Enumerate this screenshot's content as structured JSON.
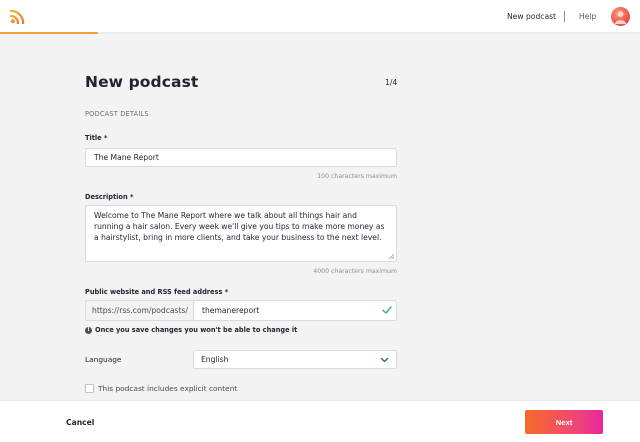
{
  "header": {
    "nav_new_podcast": "New podcast",
    "nav_help": "Help",
    "progress_fraction": 0.25,
    "logo_icon": "rss-icon",
    "accent_color": "#f0a23a"
  },
  "page": {
    "title": "New podcast",
    "step": "1/4",
    "section": "PODCAST DETAILS"
  },
  "form": {
    "title_label": "Title",
    "title_value": "The Mane Report",
    "title_hint": "100 characters maximum",
    "description_label": "Description",
    "description_value": "Welcome to The Mane Report where we talk about all things hair and running a hair salon. Every week we'll give you tips to make more money as a hairstylist, bring in more clients, and take your business to the next level.",
    "description_hint": "4000 characters maximum",
    "url_label": "Public website and RSS feed address",
    "url_prefix": "https://rss.com/podcasts/",
    "url_value": "themanereport",
    "url_warning": "Once you save changes you won't be able to change it",
    "required_mark": "*",
    "language_label": "Language",
    "language_value": "English",
    "explicit_label": "This podcast includes explicit content",
    "explicit_checked": false
  },
  "footer": {
    "cancel_label": "Cancel",
    "next_label": "Next"
  }
}
